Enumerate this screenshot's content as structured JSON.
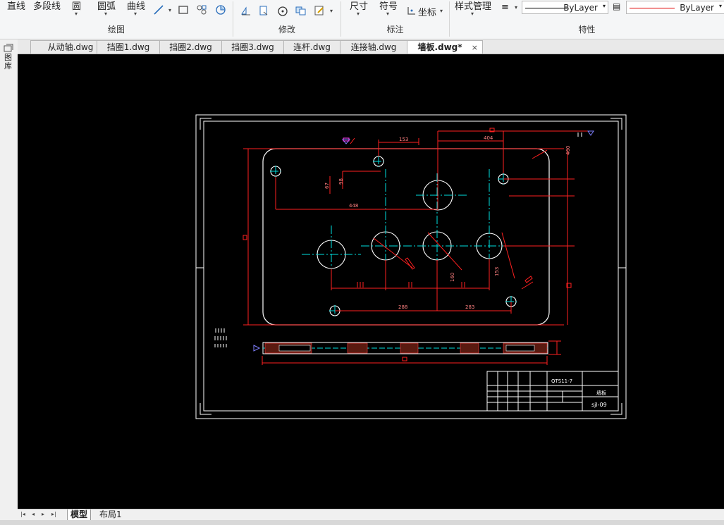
{
  "ribbon": {
    "draw": {
      "title": "绘图",
      "line": "直线",
      "polyline": "多段线",
      "circle": "圆",
      "arc": "圆弧",
      "curve": "曲线"
    },
    "modify": {
      "title": "修改"
    },
    "annotate": {
      "title": "标注",
      "dimension": "尺寸",
      "symbol": "符号",
      "coordinate": "坐标"
    },
    "properties": {
      "title": "特性",
      "style_manager": "样式管理",
      "linetype": "ByLayer",
      "color": "ByLayer",
      "color_hex": "#e00000"
    }
  },
  "left_strip": {
    "label": "图库"
  },
  "tabs": [
    {
      "label": "从动轴.dwg"
    },
    {
      "label": "挡圈1.dwg"
    },
    {
      "label": "挡圈2.dwg"
    },
    {
      "label": "挡圈3.dwg"
    },
    {
      "label": "连杆.dwg"
    },
    {
      "label": "连接轴.dwg"
    },
    {
      "label": "墙板.dwg*",
      "active": true
    }
  ],
  "close_tab": "×",
  "drawing": {
    "dims": {
      "d1": "153",
      "d2": "404",
      "d3": "67",
      "d4": "98",
      "d5": "448",
      "d6": "288",
      "d7": "283",
      "d8": "160",
      "d9": "153",
      "d10": "460"
    },
    "title_block": {
      "code": "QTS11-7",
      "name": "墙板",
      "number": "sjl-09"
    }
  },
  "bottom": {
    "model_tab": "模型",
    "layout_tab": "布局1"
  }
}
